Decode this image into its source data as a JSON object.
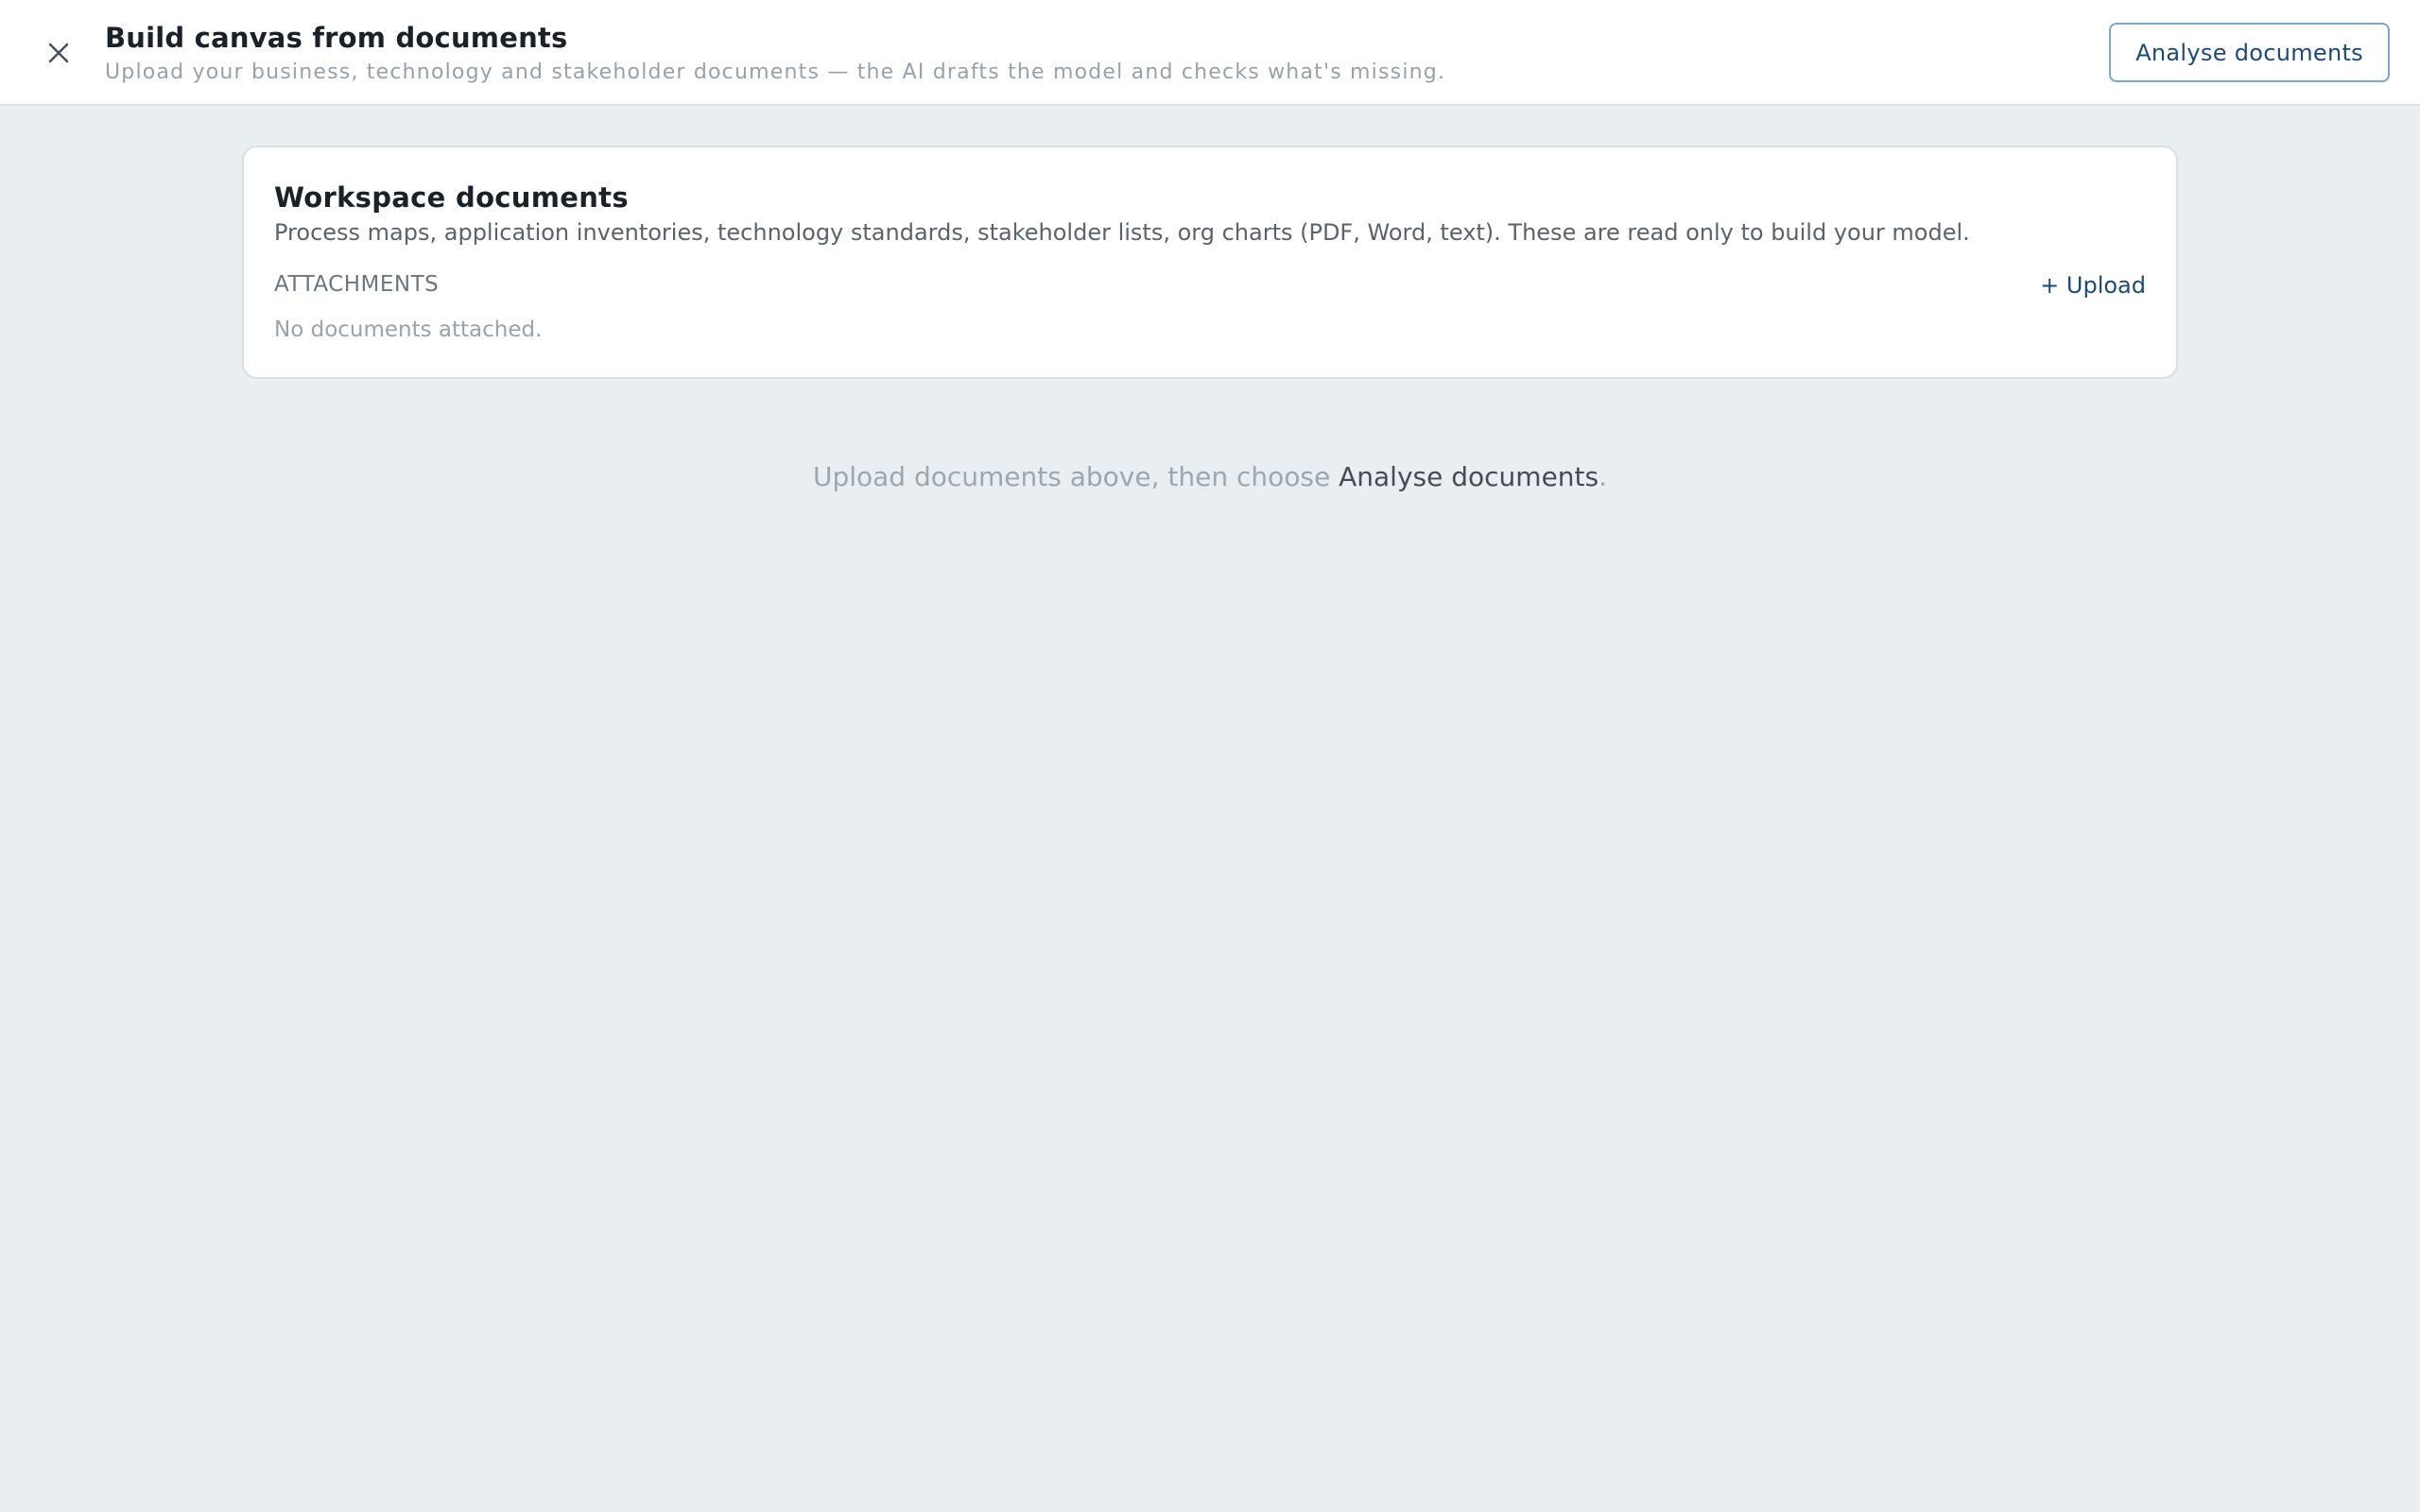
{
  "header": {
    "close_icon": "close-icon",
    "title": "Build canvas from documents",
    "subtitle": "Upload your business, technology and stakeholder documents — the AI drafts the model and checks what's missing.",
    "analyse_button_label": "Analyse documents"
  },
  "card": {
    "title": "Workspace documents",
    "description": "Process maps, application inventories, technology standards, stakeholder lists, org charts (PDF, Word, text). These are read only to build your model.",
    "attachments_label": "ATTACHMENTS",
    "upload_label": "+ Upload",
    "empty_text": "No documents attached."
  },
  "hint": {
    "before": "Upload documents above, then choose ",
    "emphasis": "Analyse documents",
    "after": "."
  },
  "colors": {
    "background": "#e9eef2",
    "accent": "#1d4a74",
    "button_border": "#7aa7cc"
  }
}
